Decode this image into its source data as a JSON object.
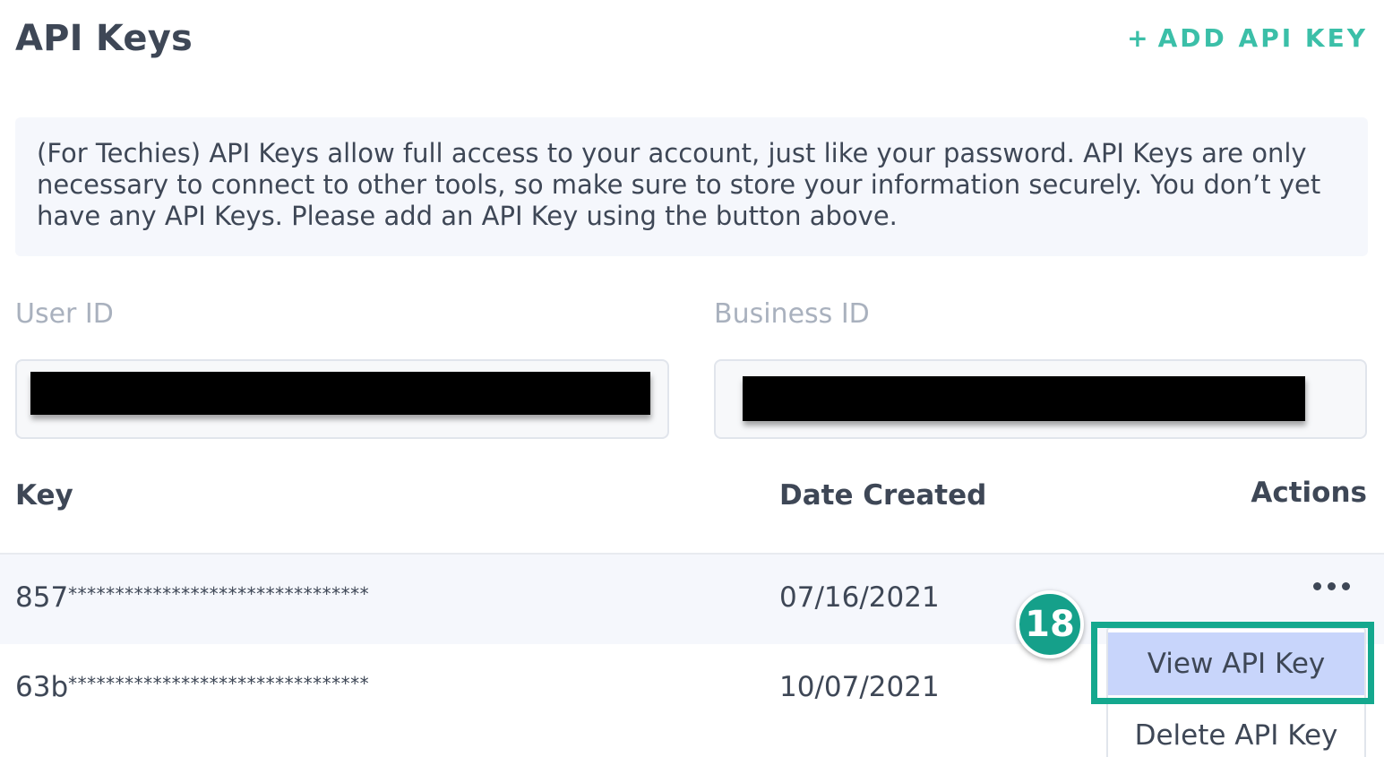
{
  "header": {
    "title": "API Keys",
    "add_button_icon": "plus-icon",
    "add_button_label": "ADD API KEY"
  },
  "info": {
    "text": "(For Techies) API Keys allow full access to your account, just like your password. API Keys are only necessary to connect to other tools, so make sure to store your information securely. You don’t yet have any API Keys. Please add an API Key using the button above."
  },
  "fields": {
    "user_id_label": "User ID",
    "business_id_label": "Business ID"
  },
  "table": {
    "headers": [
      "Key",
      "Date Created",
      "Actions"
    ],
    "rows": [
      {
        "key_prefix": "857",
        "key_mask": "********************************",
        "date": "07/16/2021"
      },
      {
        "key_prefix": "63b",
        "key_mask": "********************************",
        "date": "10/07/2021"
      }
    ]
  },
  "actions_menu": {
    "trigger_icon": "more-horizontal-icon",
    "items": [
      "View API Key",
      "Delete API Key"
    ],
    "highlighted_item": "View API Key"
  },
  "annotation": {
    "step_number": "18"
  },
  "colors": {
    "accent": "#3bbfa8",
    "badge": "#15a08a",
    "highlight_border": "#14a88e",
    "selected_item_bg": "#c8d5fb",
    "text": "#3e4756",
    "muted": "#a9b1be",
    "info_bg": "#f5f7fc"
  }
}
